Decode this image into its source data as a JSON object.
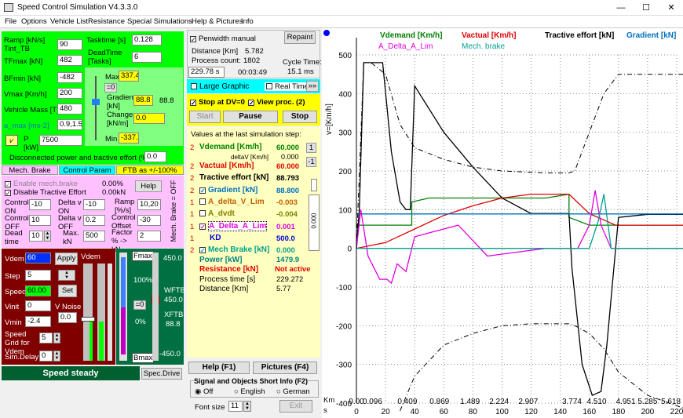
{
  "window": {
    "title": "Speed Control Simulation V4.3.3.0",
    "min": "—",
    "max": "☐",
    "close": "✕"
  },
  "menu": [
    "File",
    "Options",
    "Vehicle List",
    "Resistance",
    "Special Simulations",
    "Help & Pictures",
    "Info"
  ],
  "params": {
    "ramp_label": "Ramp [kN/s]",
    "ramp_label2": "Tint_TB",
    "ramp": "90",
    "tasktime_label": "Tasktime [s]",
    "tasktime": "0.128",
    "tfmax_label": "TFmax [kN]",
    "tfmax": "482",
    "deadtime_label": "DeadTime [Tasks]",
    "deadtime": "6",
    "bfmin_label": "BFmin [kN]",
    "bfmin": "-482",
    "vmax_label": "Vmax [Km/h]",
    "vmax": "200",
    "mass_label": "Vehicle Mass [T]",
    "mass": "480",
    "amax_label": "a_max [ms-2]",
    "amax": "0.9,1.5",
    "p_label": "P [kW]",
    "p": "7500",
    "disc_label": "Disconnected power and tractive effort (%)",
    "disc": "0.0"
  },
  "gradient": {
    "max_label": "Max",
    "max": "337.4",
    "eq0": "=0",
    "grad_label": "Gradient [kN]",
    "grad": "88.8",
    "grad2": "88.8",
    "change_label": "Change [kN/m]",
    "change": "0.0",
    "min_label": "Min",
    "min": "-337.4"
  },
  "tabs": {
    "mech": "Mech. Brake",
    "ctrl": "Control Param",
    "ftb": "FTB as +/-100%"
  },
  "mech": {
    "enable": "Enable mech.brake",
    "enable_val": "0.00%",
    "disable": "Disable Tractive Effort",
    "disable_val": "0.00kN",
    "help": "Help",
    "cont_on_l": "Control ON",
    "cont_on": "-10",
    "dv_on_l": "Delta v ON",
    "dv_on": "-10",
    "rampps_l": "Ramp [%/s]",
    "rampps": "10,20",
    "cont_off_l": "Control OFF",
    "cont_off": "10",
    "dv_off_l": "Delta v OFF",
    "dv_off": "0.2",
    "co_l": "Control Offset",
    "co": "-30",
    "dead_l": "Dead time",
    "dead": "10",
    "maxkn_l": "Max. kN",
    "maxkn": "500",
    "factor_l": "Factor % -> kN",
    "factor": "2",
    "side": "Mech. Brake = OFF"
  },
  "drive": {
    "vdem_l": "Vdem",
    "vdem": "60",
    "apply": "Apply",
    "vdem2": "Vdem",
    "step_l": "Step",
    "step": "5",
    "speed_l": "Speed",
    "speed": "60.00",
    "set": "Set",
    "vinit_l": "Vinit",
    "vinit": "0",
    "vnoise_l": "V Noise",
    "vnoise": "0.0",
    "vmin_l": "Vmin",
    "vmin": "-2.4",
    "grid_l": "Speed Grid for Vdem",
    "grid": "5",
    "delay_l": "Sim.Delay",
    "delay": "0",
    "status": "Speed steady",
    "spec": "Spec.Drive"
  },
  "bars": {
    "fmax": "Fmax",
    "top": "450.0",
    "pct100": "100%",
    "eq0": "=0",
    "pct0": "0%",
    "bmax": "Bmax",
    "bottom": "-450.0",
    "wftb": "WFTB",
    "wftb_v": "450.0",
    "xftb": "XFTB",
    "xftb_v": "88.8"
  },
  "sim": {
    "penwidth": "Penwidth manual",
    "repaint": "Repaint",
    "dist_l": "Distance [Km]",
    "dist": "5.782",
    "proc_l": "Process count:",
    "proc": "1802",
    "cycle_l": "Cycle Time:",
    "cycle": "15.1 ms",
    "time1": "229.78 s",
    "time2": "00:03:49",
    "large": "Large Graphic",
    "real": "Real Time",
    "arrows": "»»",
    "stop_dv": "Stop at DV=0",
    "view_proc": "View proc. (2)",
    "start": "Start",
    "pause": "Pause",
    "stop": "Stop"
  },
  "values": {
    "header": "Values at the last simulation step:",
    "vdemand_l": "Vdemand [Km/h]",
    "vdemand": "60.000",
    "deltav_l": "deltaV [Km/h]",
    "deltav": "0.000",
    "vactual_l": "Vactual [Km/h]",
    "vactual": "60.000",
    "te_l": "Tractive effort [kN]",
    "te": "88.793",
    "grad_l": "Gradient [kN]",
    "grad": "88.800",
    "adv_l": "A_delta_V_Lim",
    "adv": "-0.003",
    "advdt_l": "A_dvdt",
    "advdt": "-0.004",
    "adal_l": "A_Delta_A_Lim",
    "adal": "0.001",
    "kd_l": "KD",
    "kd": "500.0",
    "mb_l": "Mech Brake [kN]",
    "mb": "0.000",
    "power_l": "Power [kW]",
    "power": "1479.9",
    "res_l": "Resistance [kN]",
    "res": "Not active",
    "pt_l": "Process time [s]",
    "pt": "229.272",
    "distance_l": "Distance [Km]",
    "distance": "5.77",
    "one": "1",
    "minus1": "-1",
    "vbox": "0.000",
    "n2": "2",
    "n1": "1"
  },
  "bottom": {
    "help": "Help  (F1)",
    "pictures": "Pictures (F4)",
    "sig_title": "Signal and Objects Short Info (F2)",
    "off": "Off",
    "english": "English",
    "german": "German",
    "fs_l": "Font size",
    "fs": "11",
    "exit": "Exit"
  },
  "legend": {
    "vdemand": "Vdemand [Km/h]",
    "vactual": "Vactual [Km/h]",
    "te": "Tractive effort [kN]",
    "grad": "Gradient [kN]",
    "adal": "A_Delta_A_Lim",
    "mb": "Mech. brake"
  },
  "colors": {
    "vdemand": "#008000",
    "vactual": "#e00000",
    "te": "#000000",
    "grad": "#0070c0",
    "adal": "#e000e0",
    "mb": "#00a090"
  },
  "chart_data": {
    "type": "line",
    "ylabel": "v=[Km/h]",
    "ylim": [
      -400,
      500
    ],
    "yticks": [
      500,
      400,
      300,
      200,
      100,
      0,
      -100,
      -200,
      -300,
      -400
    ],
    "xlim": [
      0,
      220
    ],
    "xticks": [
      0,
      20,
      40,
      60,
      80,
      100,
      120,
      140,
      160,
      180,
      200,
      220
    ],
    "km_label": "Km",
    "s_label": "s",
    "km_ticks": [
      {
        "x": 0,
        "l": "0.00"
      },
      {
        "x": 11,
        "l": "0.096"
      },
      {
        "x": 35,
        "l": "0.409"
      },
      {
        "x": 57,
        "l": "0.869"
      },
      {
        "x": 78,
        "l": "1.489"
      },
      {
        "x": 98,
        "l": "2.224"
      },
      {
        "x": 118,
        "l": "2.907"
      },
      {
        "x": 148,
        "l": "3.774"
      },
      {
        "x": 165,
        "l": "4.510"
      },
      {
        "x": 185,
        "l": "4.951"
      },
      {
        "x": 200,
        "l": "5.285"
      },
      {
        "x": 216,
        "l": "5.618"
      }
    ],
    "series": [
      {
        "name": "Vdemand [Km/h]",
        "color": "#008000",
        "x": [
          0,
          20,
          38,
          38,
          50,
          130,
          146,
          146,
          160,
          176,
          230
        ],
        "y": [
          60,
          60,
          60,
          120,
          130,
          130,
          140,
          80,
          60,
          60,
          60
        ]
      },
      {
        "name": "Vactual [Km/h]",
        "color": "#e00000",
        "x": [
          0,
          20,
          40,
          60,
          80,
          100,
          120,
          146,
          160,
          178,
          230
        ],
        "y": [
          0,
          15,
          50,
          85,
          110,
          130,
          140,
          140,
          90,
          60,
          60
        ]
      },
      {
        "name": "Tractive effort [kN]",
        "color": "#000000",
        "x": [
          0,
          2,
          5,
          18,
          24,
          30,
          34,
          37,
          40,
          60,
          80,
          100,
          120,
          146,
          148,
          155,
          162,
          168,
          172,
          180,
          200,
          230
        ],
        "y": [
          0,
          100,
          480,
          480,
          250,
          120,
          100,
          100,
          420,
          300,
          210,
          130,
          90,
          90,
          -50,
          -300,
          -380,
          -370,
          -250,
          80,
          88,
          88
        ]
      },
      {
        "name": "Gradient [kN]",
        "color": "#0070c0",
        "x": [
          0,
          230
        ],
        "y": [
          89,
          89
        ]
      },
      {
        "name": "A_Delta_A_Lim",
        "color": "#e000e0",
        "x": [
          0,
          3,
          8,
          16,
          21,
          24,
          28,
          34,
          40,
          50,
          70,
          80,
          90,
          110,
          130,
          146,
          152,
          160,
          164,
          168,
          175,
          230
        ],
        "y": [
          0,
          100,
          -20,
          -80,
          -80,
          -90,
          -40,
          -60,
          30,
          40,
          60,
          20,
          -20,
          -10,
          0,
          0,
          0,
          60,
          150,
          60,
          0,
          0
        ]
      },
      {
        "name": "Mech. brake",
        "color": "#00a090",
        "x": [
          0,
          150,
          160,
          166,
          170,
          175,
          230
        ],
        "y": [
          0,
          0,
          0,
          70,
          140,
          0,
          0
        ]
      },
      {
        "name": "Tractive limit +",
        "color": "#000000",
        "dash": true,
        "x": [
          0,
          5,
          10,
          20,
          30,
          40,
          60,
          80,
          100,
          130,
          146,
          150,
          160,
          170,
          180,
          200,
          230
        ],
        "y": [
          0,
          480,
          480,
          450,
          320,
          260,
          230,
          210,
          200,
          195,
          195,
          200,
          300,
          400,
          450,
          450,
          450
        ]
      },
      {
        "name": "Tractive limit -",
        "color": "#000000",
        "dash": true,
        "x": [
          30,
          40,
          60,
          80,
          100,
          120,
          146,
          150,
          160,
          170,
          180,
          200,
          230
        ],
        "y": [
          -420,
          -330,
          -250,
          -220,
          -200,
          -195,
          -195,
          -200,
          -220,
          -260,
          -320,
          -380,
          -420
        ]
      }
    ]
  }
}
